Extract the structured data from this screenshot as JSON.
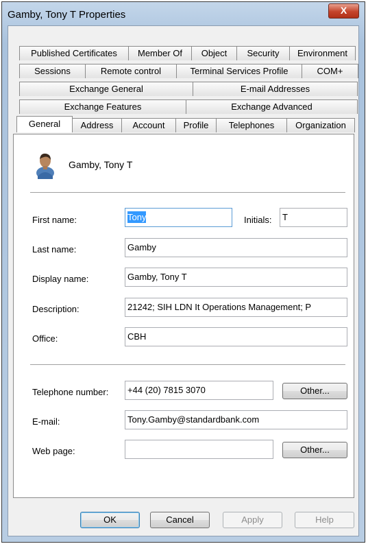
{
  "window": {
    "title": "Gamby, Tony T Properties",
    "close_label": "X"
  },
  "tabs": {
    "row1": [
      "Published Certificates",
      "Member Of",
      "Object",
      "Security",
      "Environment"
    ],
    "row2": [
      "Sessions",
      "Remote control",
      "Terminal Services Profile",
      "COM+"
    ],
    "row3": [
      "Exchange General",
      "E-mail Addresses"
    ],
    "row4": [
      "Exchange Features",
      "Exchange Advanced"
    ],
    "row5": [
      "General",
      "Address",
      "Account",
      "Profile",
      "Telephones",
      "Organization"
    ],
    "active": "General"
  },
  "general": {
    "header_name": "Gamby, Tony T",
    "first_name_label": "First name:",
    "first_name": "Tony",
    "initials_label": "Initials:",
    "initials": "T",
    "last_name_label": "Last name:",
    "last_name": "Gamby",
    "display_name_label": "Display name:",
    "display_name": "Gamby, Tony T",
    "description_label": "Description:",
    "description": "21242; SIH LDN It Operations Management; P",
    "office_label": "Office:",
    "office": "CBH",
    "telephone_label": "Telephone number:",
    "telephone": "+44 (20) 7815 3070",
    "other_label": "Other...",
    "email_label": "E-mail:",
    "email": "Tony.Gamby@standardbank.com",
    "webpage_label": "Web page:",
    "webpage": "",
    "webpage_other_label": "Other..."
  },
  "buttons": {
    "ok": "OK",
    "cancel": "Cancel",
    "apply": "Apply",
    "help": "Help"
  }
}
